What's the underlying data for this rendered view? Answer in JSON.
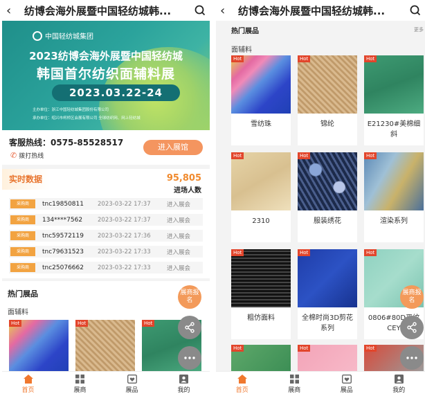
{
  "header": {
    "back_icon": "back-arrow-icon",
    "title": "纺博会海外展暨中国轻纺城韩...",
    "search_icon": "search-icon"
  },
  "banner": {
    "logo_text": "中国轻纺城集团",
    "line1": "2023纺博会海外展暨中国轻纺城",
    "line2": "韩国首尔纺织面辅料展",
    "date": "2023.03.22-24",
    "organizer": "主办单位：浙江中国轻纺城集团股份有限公司",
    "co_organizer": "承办单位：绍兴市柯桥区会展有限公司 全球纺织网、网上轻纺城"
  },
  "hotline": {
    "label": "客服热线：0575-85528517",
    "dial": "拨打热线",
    "enter": "进入展馆"
  },
  "stats": {
    "tag": "实时数据",
    "count": "95,805",
    "count_label": "进场人数",
    "rows": [
      {
        "badge": "采购商",
        "account": "tnc19850811",
        "time": "2023-03-22 17:37",
        "action": "进入展会"
      },
      {
        "badge": "采购商",
        "account": "134****7562",
        "time": "2023-03-22 17:37",
        "action": "进入展会"
      },
      {
        "badge": "采购商",
        "account": "tnc59572119",
        "time": "2023-03-22 17:36",
        "action": "进入展会"
      },
      {
        "badge": "采购商",
        "account": "tnc79631523",
        "time": "2023-03-22 17:33",
        "action": "进入展会"
      },
      {
        "badge": "采购商",
        "account": "tnc25076662",
        "time": "2023-03-22 17:33",
        "action": "进入展会"
      }
    ]
  },
  "hot": {
    "title": "热门展品",
    "more": "更多",
    "category": "面辅料",
    "badge": "Hot"
  },
  "fab": {
    "register": "展商报名",
    "share_icon": "share-icon",
    "more_icon": "more-dots-icon"
  },
  "products": [
    {
      "name": "雪纺珠"
    },
    {
      "name": "锦纶"
    },
    {
      "name": "E21230#美棉细斜"
    },
    {
      "name": "2310"
    },
    {
      "name": "服装绣花"
    },
    {
      "name": "渲染系列"
    },
    {
      "name": "粗仿面料"
    },
    {
      "name": "全棉时尚3D剪花系列"
    },
    {
      "name": "0806#80D平纹CEY"
    }
  ],
  "tabs": [
    {
      "label": "首页",
      "icon": "home-icon"
    },
    {
      "label": "展商",
      "icon": "grid-icon"
    },
    {
      "label": "展品",
      "icon": "heart-box-icon"
    },
    {
      "label": "我的",
      "icon": "user-icon"
    }
  ],
  "colors": {
    "accent": "#f0782e",
    "hot": "#e2452b",
    "banner": "#2ba39c"
  }
}
